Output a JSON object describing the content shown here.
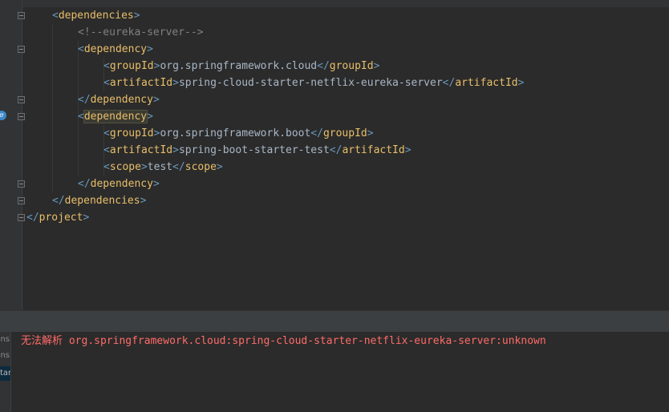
{
  "editor": {
    "lines": [
      {
        "indent": 1,
        "parts": [
          [
            "br",
            "<"
          ],
          [
            "tag",
            "dependencies"
          ],
          [
            "br",
            ">"
          ]
        ]
      },
      {
        "indent": 2,
        "parts": [
          [
            "cmt",
            "<!--eureka-server-->"
          ]
        ]
      },
      {
        "indent": 2,
        "parts": [
          [
            "br",
            "<"
          ],
          [
            "tag",
            "dependency"
          ],
          [
            "br",
            ">"
          ]
        ]
      },
      {
        "indent": 3,
        "parts": [
          [
            "br",
            "<"
          ],
          [
            "tag",
            "groupId"
          ],
          [
            "br",
            ">"
          ],
          [
            "txt",
            "org.springframework.cloud"
          ],
          [
            "br",
            "</"
          ],
          [
            "tag",
            "groupId"
          ],
          [
            "br",
            ">"
          ]
        ]
      },
      {
        "indent": 3,
        "parts": [
          [
            "br",
            "<"
          ],
          [
            "tag",
            "artifactId"
          ],
          [
            "br",
            ">"
          ],
          [
            "txt",
            "spring-cloud-starter-netflix-eureka-server"
          ],
          [
            "br",
            "</"
          ],
          [
            "tag",
            "artifactId"
          ],
          [
            "br",
            ">"
          ]
        ]
      },
      {
        "indent": 2,
        "parts": [
          [
            "br",
            "</"
          ],
          [
            "tag",
            "dependency"
          ],
          [
            "br",
            ">"
          ]
        ]
      },
      {
        "indent": 2,
        "parts": [
          [
            "br",
            "<"
          ],
          [
            "tag hl",
            "dependency"
          ],
          [
            "br",
            ">"
          ]
        ]
      },
      {
        "indent": 3,
        "parts": [
          [
            "br",
            "<"
          ],
          [
            "tag",
            "groupId"
          ],
          [
            "br",
            ">"
          ],
          [
            "txt",
            "org.springframework.boot"
          ],
          [
            "br",
            "</"
          ],
          [
            "tag",
            "groupId"
          ],
          [
            "br",
            ">"
          ]
        ]
      },
      {
        "indent": 3,
        "parts": [
          [
            "br",
            "<"
          ],
          [
            "tag",
            "artifactId"
          ],
          [
            "br",
            ">"
          ],
          [
            "txt",
            "spring-boot-starter-test"
          ],
          [
            "br",
            "</"
          ],
          [
            "tag",
            "artifactId"
          ],
          [
            "br",
            ">"
          ]
        ]
      },
      {
        "indent": 3,
        "parts": [
          [
            "br",
            "<"
          ],
          [
            "tag",
            "scope"
          ],
          [
            "br",
            ">"
          ],
          [
            "txt",
            "test"
          ],
          [
            "br",
            "</"
          ],
          [
            "tag",
            "scope"
          ],
          [
            "br",
            ">"
          ]
        ]
      },
      {
        "indent": 2,
        "parts": [
          [
            "br",
            "</"
          ],
          [
            "tag",
            "dependency"
          ],
          [
            "br",
            ">"
          ]
        ]
      },
      {
        "indent": 1,
        "parts": [
          [
            "br",
            "</"
          ],
          [
            "tag",
            "dependencies"
          ],
          [
            "br",
            ">"
          ]
        ]
      },
      {
        "indent": 0,
        "parts": [
          [
            "br",
            "</"
          ],
          [
            "tag",
            "project"
          ],
          [
            "br",
            ">"
          ]
        ]
      }
    ]
  },
  "gutter": {
    "icon": "run-config-icon",
    "icon_glyph": "ơ"
  },
  "problems": {
    "side_tabs": [
      "ns",
      "ns",
      "tar"
    ],
    "message_prefix": "无法解析",
    "message": "org.springframework.cloud:spring-cloud-starter-netflix-eureka-server:unknown"
  },
  "colors": {
    "background": "#2b2b2b",
    "tag": "#e8bf6a",
    "bracket": "#6897bb",
    "error": "#ff6b68"
  }
}
